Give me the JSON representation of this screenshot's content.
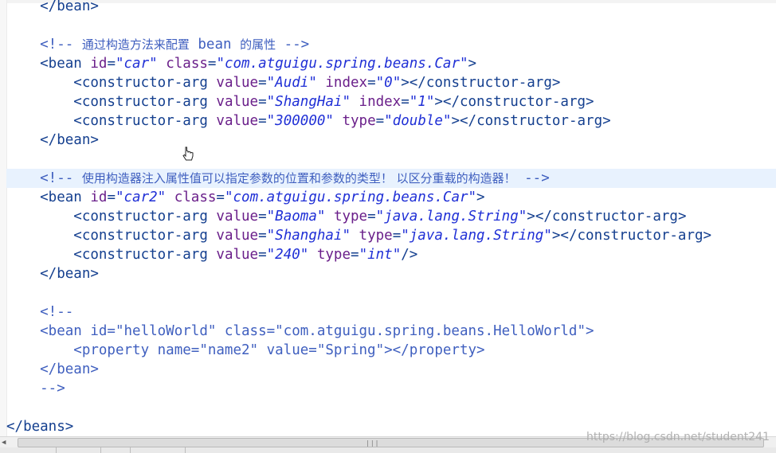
{
  "editor": {
    "lines": [
      {
        "tokens": [
          {
            "t": "tag",
            "v": "    </bean>"
          }
        ]
      },
      {
        "tokens": []
      },
      {
        "tokens": [
          {
            "t": "cmt",
            "v": "    <!-- "
          },
          {
            "t": "cmtcjk",
            "v": "通过构造方法来配置"
          },
          {
            "t": "cmt",
            "v": " bean "
          },
          {
            "t": "cmtcjk",
            "v": "的属性"
          },
          {
            "t": "cmt",
            "v": " -->"
          }
        ]
      },
      {
        "tokens": [
          {
            "t": "tag",
            "v": "    <bean "
          },
          {
            "t": "attr",
            "v": "id"
          },
          {
            "t": "pun",
            "v": "="
          },
          {
            "t": "val",
            "v": "\"car\""
          },
          {
            "t": "attr",
            "v": " class"
          },
          {
            "t": "pun",
            "v": "="
          },
          {
            "t": "val",
            "v": "\"com.atguigu.spring.beans.Car\""
          },
          {
            "t": "tag",
            "v": ">"
          }
        ]
      },
      {
        "tokens": [
          {
            "t": "tag",
            "v": "        <constructor-arg "
          },
          {
            "t": "attr",
            "v": "value"
          },
          {
            "t": "pun",
            "v": "="
          },
          {
            "t": "val",
            "v": "\"Audi\""
          },
          {
            "t": "attr",
            "v": " index"
          },
          {
            "t": "pun",
            "v": "="
          },
          {
            "t": "val",
            "v": "\"0\""
          },
          {
            "t": "tag",
            "v": "></constructor-arg>"
          }
        ]
      },
      {
        "tokens": [
          {
            "t": "tag",
            "v": "        <constructor-arg "
          },
          {
            "t": "attr",
            "v": "value"
          },
          {
            "t": "pun",
            "v": "="
          },
          {
            "t": "val",
            "v": "\"ShangHai\""
          },
          {
            "t": "attr",
            "v": " index"
          },
          {
            "t": "pun",
            "v": "="
          },
          {
            "t": "val",
            "v": "\"1\""
          },
          {
            "t": "tag",
            "v": "></constructor-arg>"
          }
        ]
      },
      {
        "tokens": [
          {
            "t": "tag",
            "v": "        <constructor-arg "
          },
          {
            "t": "attr",
            "v": "value"
          },
          {
            "t": "pun",
            "v": "="
          },
          {
            "t": "val",
            "v": "\"300000\""
          },
          {
            "t": "attr",
            "v": " type"
          },
          {
            "t": "pun",
            "v": "="
          },
          {
            "t": "val",
            "v": "\"double\""
          },
          {
            "t": "tag",
            "v": "></constructor-arg>"
          }
        ]
      },
      {
        "tokens": [
          {
            "t": "tag",
            "v": "    </bean>"
          }
        ]
      },
      {
        "tokens": []
      },
      {
        "hl": true,
        "tokens": [
          {
            "t": "cmt",
            "v": "    <!-- "
          },
          {
            "t": "cmtcjk",
            "v": "使用构造器注入属性值可以指定参数的位置和参数的类型！ 以区分重载的构造器！"
          },
          {
            "t": "cmt",
            "v": " -->"
          }
        ]
      },
      {
        "tokens": [
          {
            "t": "tag",
            "v": "    <bean "
          },
          {
            "t": "attr",
            "v": "id"
          },
          {
            "t": "pun",
            "v": "="
          },
          {
            "t": "val",
            "v": "\"car2\""
          },
          {
            "t": "attr",
            "v": " class"
          },
          {
            "t": "pun",
            "v": "="
          },
          {
            "t": "val",
            "v": "\"com.atguigu.spring.beans.Car\""
          },
          {
            "t": "tag",
            "v": ">"
          }
        ]
      },
      {
        "tokens": [
          {
            "t": "tag",
            "v": "        <constructor-arg "
          },
          {
            "t": "attr",
            "v": "value"
          },
          {
            "t": "pun",
            "v": "="
          },
          {
            "t": "val",
            "v": "\"Baoma\""
          },
          {
            "t": "attr",
            "v": " type"
          },
          {
            "t": "pun",
            "v": "="
          },
          {
            "t": "val",
            "v": "\"java.lang.String\""
          },
          {
            "t": "tag",
            "v": "></constructor-arg>"
          }
        ]
      },
      {
        "tokens": [
          {
            "t": "tag",
            "v": "        <constructor-arg "
          },
          {
            "t": "attr",
            "v": "value"
          },
          {
            "t": "pun",
            "v": "="
          },
          {
            "t": "val",
            "v": "\"Shanghai\""
          },
          {
            "t": "attr",
            "v": " type"
          },
          {
            "t": "pun",
            "v": "="
          },
          {
            "t": "val",
            "v": "\"java.lang.String\""
          },
          {
            "t": "tag",
            "v": "></constructor-arg>"
          }
        ]
      },
      {
        "tokens": [
          {
            "t": "tag",
            "v": "        <constructor-arg "
          },
          {
            "t": "attr",
            "v": "value"
          },
          {
            "t": "pun",
            "v": "="
          },
          {
            "t": "val",
            "v": "\"240\""
          },
          {
            "t": "attr",
            "v": " type"
          },
          {
            "t": "pun",
            "v": "="
          },
          {
            "t": "val",
            "v": "\"int\""
          },
          {
            "t": "tag",
            "v": "/>"
          }
        ]
      },
      {
        "tokens": [
          {
            "t": "tag",
            "v": "    </bean>"
          }
        ]
      },
      {
        "tokens": []
      },
      {
        "tokens": [
          {
            "t": "cmt",
            "v": "    <!--"
          }
        ]
      },
      {
        "tokens": [
          {
            "t": "cmt",
            "v": "    <bean id=\"helloWorld\" class=\"com.atguigu.spring.beans.HelloWorld\">"
          }
        ]
      },
      {
        "tokens": [
          {
            "t": "cmt",
            "v": "        <property name=\"name2\" value=\"Spring\"></property>"
          }
        ]
      },
      {
        "tokens": [
          {
            "t": "cmt",
            "v": "    </bean>"
          }
        ]
      },
      {
        "tokens": [
          {
            "t": "cmt",
            "v": "    -->"
          }
        ]
      },
      {
        "tokens": []
      },
      {
        "tokens": [
          {
            "t": "tag",
            "v": "</beans>"
          }
        ]
      }
    ]
  },
  "watermark": "https://blog.csdn.net/student241",
  "colors": {
    "tag": "#143f8f",
    "attribute": "#6a1f8a",
    "value": "#1f2fd6",
    "comment": "#3f5fbf",
    "highlight_line": "#e8f2fe"
  },
  "icons": {
    "cursor": "hand-pointer-icon",
    "scroll_left": "triangle-left-icon",
    "scroll_grip": "grip-icon"
  }
}
